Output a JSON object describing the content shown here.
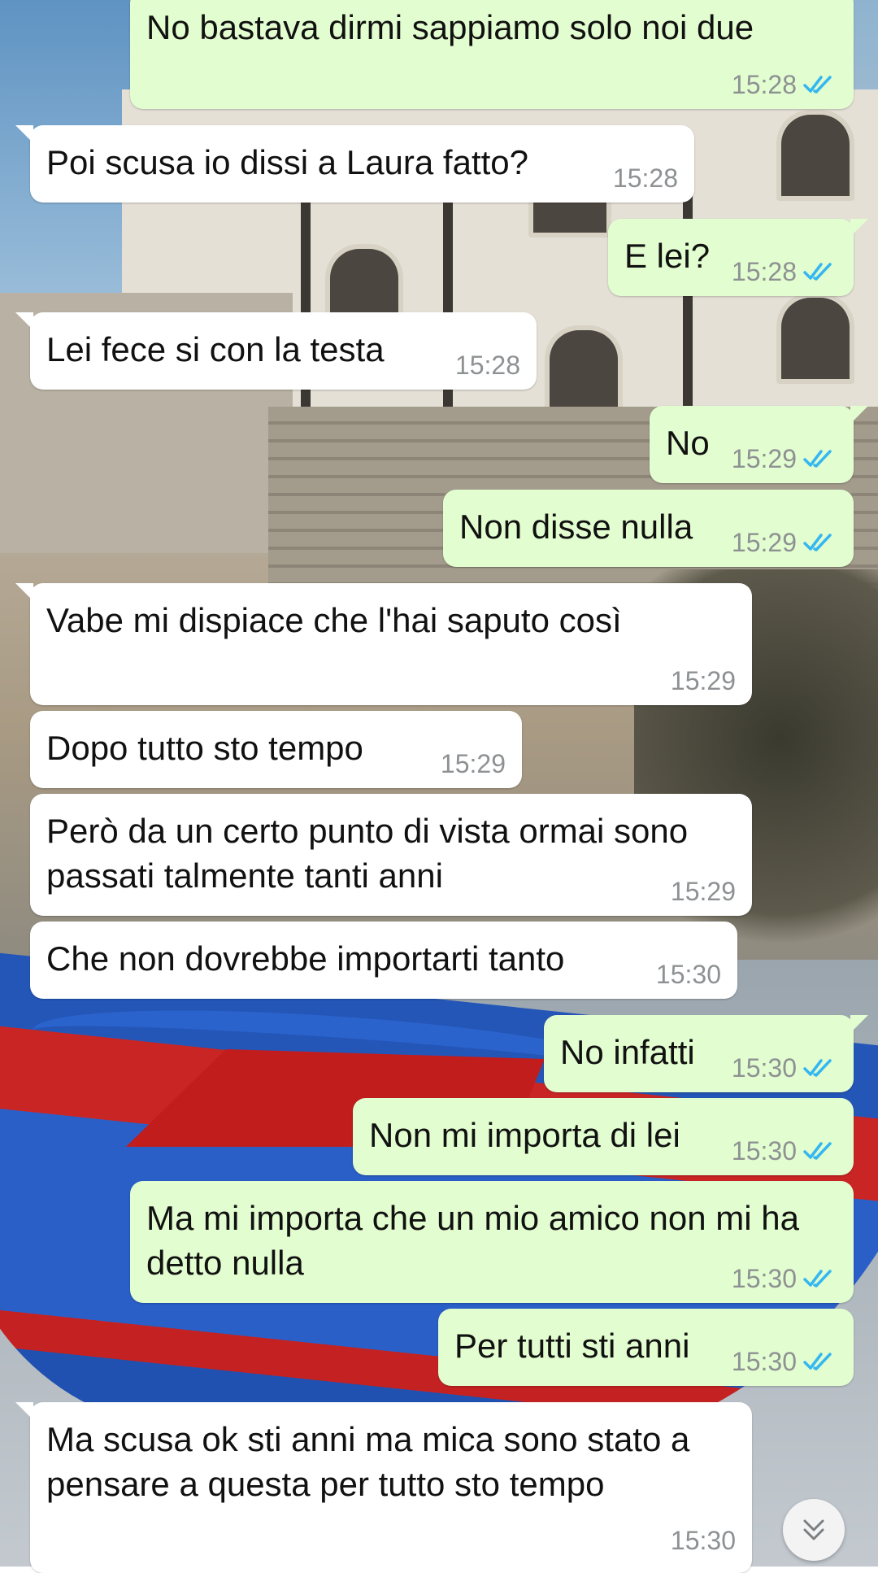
{
  "conversation": {
    "messages": [
      {
        "side": "out",
        "text": "No bastava dirmi sappiamo solo noi due",
        "time": "15:28",
        "status": "read"
      },
      {
        "side": "in",
        "text": "Poi scusa io dissi a Laura fatto?",
        "time": "15:28"
      },
      {
        "side": "out",
        "text": "E lei?",
        "time": "15:28",
        "status": "read"
      },
      {
        "side": "in",
        "text": "Lei fece si con la testa",
        "time": "15:28"
      },
      {
        "side": "out",
        "text": "No",
        "time": "15:29",
        "status": "read"
      },
      {
        "side": "out",
        "text": "Non disse nulla",
        "time": "15:29",
        "status": "read"
      },
      {
        "side": "in",
        "text": "Vabe mi dispiace che l'hai saputo così",
        "time": "15:29"
      },
      {
        "side": "in",
        "text": "Dopo tutto sto tempo",
        "time": "15:29"
      },
      {
        "side": "in",
        "text": "Però da un certo punto di vista ormai sono passati talmente tanti anni",
        "time": "15:29"
      },
      {
        "side": "in",
        "text": "Che non dovrebbe importarti tanto",
        "time": "15:30"
      },
      {
        "side": "out",
        "text": "No infatti",
        "time": "15:30",
        "status": "read"
      },
      {
        "side": "out",
        "text": "Non mi importa di lei",
        "time": "15:30",
        "status": "read"
      },
      {
        "side": "out",
        "text": "Ma mi importa che un mio amico non mi ha detto nulla",
        "time": "15:30",
        "status": "read"
      },
      {
        "side": "out",
        "text": "Per tutti sti anni",
        "time": "15:30",
        "status": "read"
      },
      {
        "side": "in",
        "text": "Ma scusa ok sti anni ma mica sono stato a pensare a questa per tutto sto tempo",
        "time": "15:30"
      }
    ]
  },
  "icons": {
    "read_receipt": "double-check-icon",
    "scroll_button": "chevron-double-down-icon"
  },
  "colors": {
    "outgoing_bubble": "#e2fdcf",
    "incoming_bubble": "#ffffff",
    "read_check": "#34b7f1",
    "timestamp": "#8e9193"
  }
}
